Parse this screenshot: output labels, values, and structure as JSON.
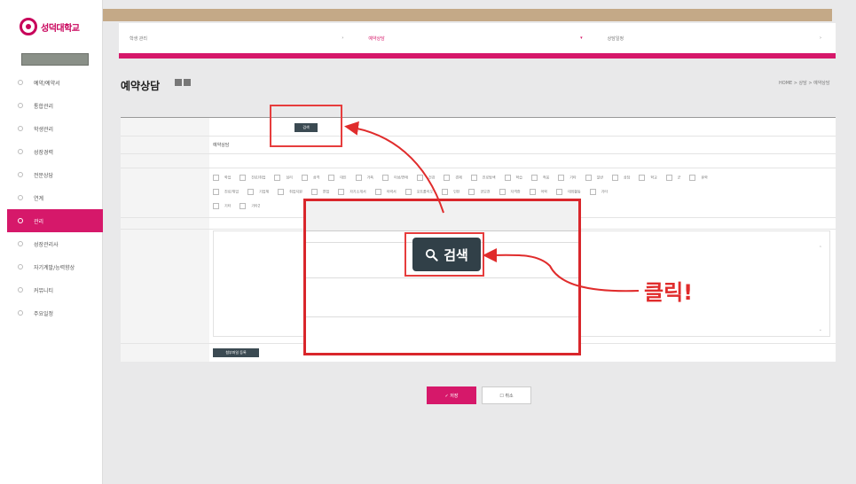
{
  "sidebar": {
    "logo_text": "성덕대학교",
    "menu": [
      {
        "label": "예약/예약서"
      },
      {
        "label": "통합관리"
      },
      {
        "label": "학생관리"
      },
      {
        "label": "성장경력"
      },
      {
        "label": "전문상담"
      },
      {
        "label": "연계"
      },
      {
        "label": "관리"
      },
      {
        "label": "성장관리사"
      },
      {
        "label": "자기계발/능력향상"
      },
      {
        "label": "커뮤니티"
      },
      {
        "label": "주요일정"
      }
    ],
    "active_index": 6
  },
  "breadcrumb_bar": {
    "segments": [
      {
        "text": "학생 관리",
        "arrow": "›"
      },
      {
        "text": "예약상담",
        "arrow": "▾"
      },
      {
        "text": "상담일정",
        "arrow": "›"
      }
    ]
  },
  "page": {
    "title": "예약상담",
    "crumb": "HOME > 상담 > 예약상담"
  },
  "form": {
    "search_button_label": "검색",
    "attach_button_label": "첨부파일 등록",
    "subject_value": "예약상담",
    "checkbox_row1": [
      "학업",
      "진로/취업",
      "심리",
      "성격",
      "대인",
      "가족",
      "이성/연애",
      "건강",
      "경제",
      "진로탐색",
      "학습",
      "적응",
      "기타",
      "일반",
      "상담",
      "학교",
      "군",
      "휴학"
    ],
    "checkbox_row2": [
      "진로/취업",
      "기업체",
      "취업지원",
      "면접",
      "자기소개서",
      "이력서",
      "포트폴리오",
      "인턴",
      "공모전",
      "자격증",
      "어학",
      "대외활동",
      "기타"
    ],
    "checkbox_row3": [
      "기타",
      "기타2"
    ]
  },
  "buttons": {
    "save_label": "✓ 저장",
    "cancel_label": "☐ 취소"
  },
  "annotation": {
    "zoom_search_label": "검색",
    "click_label": "클릭!"
  },
  "colors": {
    "brand_pink": "#d6186a",
    "annotation_red": "#e02c2c",
    "dark_button": "#314048"
  }
}
